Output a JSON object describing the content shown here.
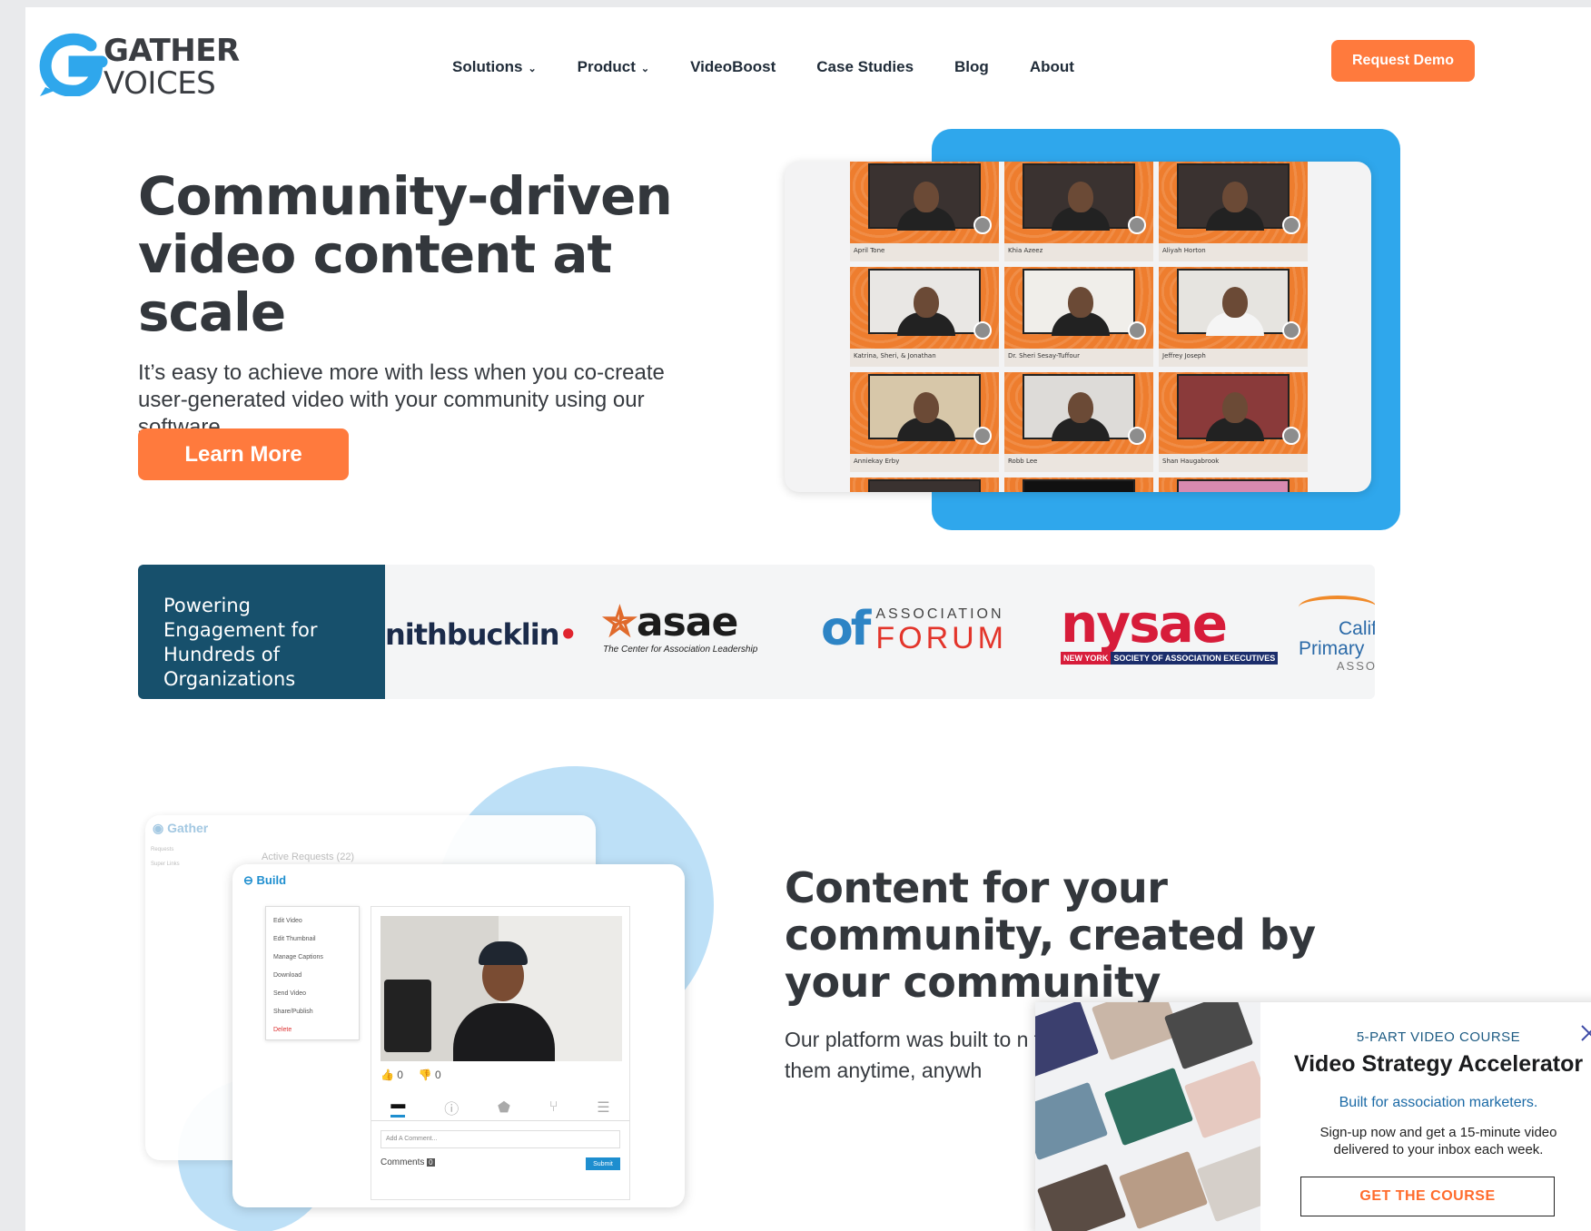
{
  "logo": {
    "line1": "GATHER",
    "line2": "VOICES",
    "brand_color": "#2fa7ec"
  },
  "nav": {
    "items": [
      {
        "label": "Solutions",
        "dropdown": true
      },
      {
        "label": "Product",
        "dropdown": true
      },
      {
        "label": "VideoBoost",
        "dropdown": false
      },
      {
        "label": "Case Studies",
        "dropdown": false
      },
      {
        "label": "Blog",
        "dropdown": false
      },
      {
        "label": "About",
        "dropdown": false
      }
    ],
    "cta": "Request Demo"
  },
  "hero": {
    "title": "Community-driven video content at scale",
    "subtitle": "It’s easy to achieve more with less when you co-create user-generated video with your community using our software.",
    "cta": "Learn More",
    "video_grid": [
      "April Tone",
      "Khia Azeez",
      "Aliyah Horton",
      "Katrina, Sheri, & Jonathan",
      "Dr. Sheri Sesay-Tuffour",
      "Jeffrey Joseph",
      "Anniekay Erby",
      "Robb Lee",
      "Shan Haugabrook"
    ]
  },
  "logos_strip": {
    "label": "Powering Engagement for Hundreds of Organizations",
    "smithbucklin": "nithbucklin",
    "asae": {
      "name": "asae",
      "tagline": "The Center for Association Leadership"
    },
    "forum": {
      "mark": "of",
      "top": "ASSOCIATION",
      "bottom": "FORUM"
    },
    "nysae": {
      "name": "nysae",
      "left": "NEW YORK",
      "right": "SOCIETY OF ASSOCIATION EXECUTIVES"
    },
    "california": {
      "t1": "Calif",
      "t2": "Primary",
      "t3": "ASSO"
    }
  },
  "section2": {
    "title": "Content for your community, created by your community",
    "body": "Our platform was built to n to co-create videos with yo with them anytime, anywh",
    "app": {
      "back_title": "Gather",
      "active_requests": "Active Requests (22)",
      "side_items": [
        "Requests",
        "Super Links"
      ],
      "build_label": "Build",
      "menu": [
        "Edit Video",
        "Edit Thumbnail",
        "Manage Captions",
        "Download",
        "Send Video",
        "Share/Publish",
        "Delete"
      ],
      "comment_placeholder": "Add A Comment...",
      "comments_label": "Comments",
      "comments_count": "0",
      "submit_label": "Submit",
      "votes_up": "0",
      "votes_down": "0"
    }
  },
  "popup": {
    "kicker": "5-PART VIDEO COURSE",
    "title": "Video Strategy Accelerator",
    "built_for": "Built for association marketers.",
    "description": "Sign-up now and get a 15-minute video delivered to your inbox each week.",
    "cta": "GET THE COURSE"
  }
}
